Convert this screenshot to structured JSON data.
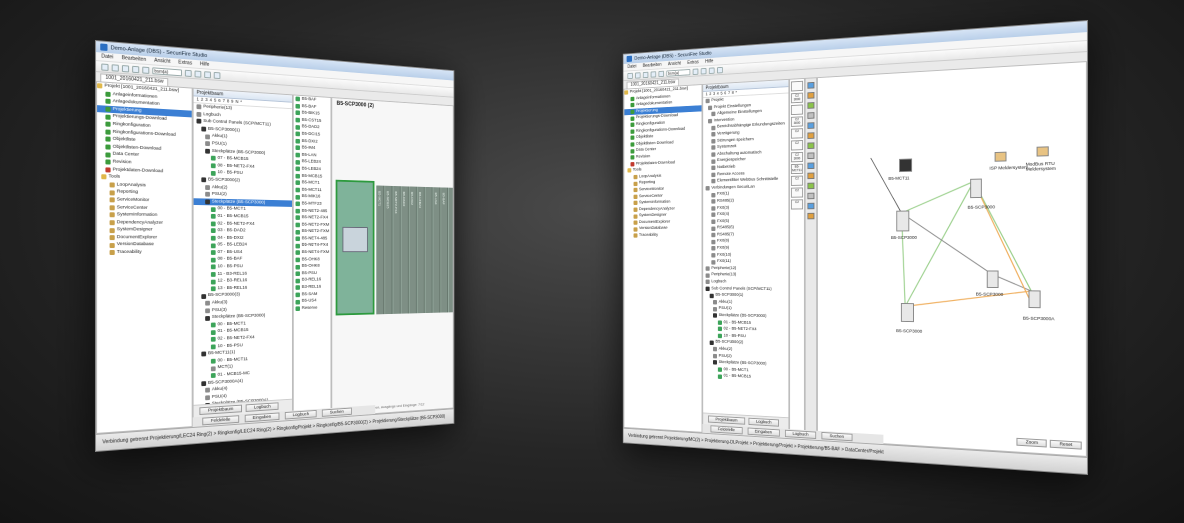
{
  "app": {
    "title": "Demo-Anlage (DBS) - SecuriFire Studio",
    "menu": [
      "Datei",
      "Bearbeiten",
      "Ansicht",
      "Extras",
      "Hilfe"
    ],
    "toolbar_select": "bsm(a)",
    "doc_tab": "1001_20160421_211.bsw"
  },
  "nav_tree": {
    "root": "Projekt [1001_20160421_211.bsw]",
    "items": [
      {
        "label": "Anlageinformationen",
        "icon": "check"
      },
      {
        "label": "Anlagedokumentation",
        "icon": "check"
      },
      {
        "label": "Projektierung",
        "icon": "check",
        "selected": true
      },
      {
        "label": "Projektierungs-Download",
        "icon": "check"
      },
      {
        "label": "Ringkonfiguration",
        "icon": "check"
      },
      {
        "label": "Ringkonfigurations-Download",
        "icon": "check"
      },
      {
        "label": "Objektliste",
        "icon": "check"
      },
      {
        "label": "Objektlisten-Download",
        "icon": "check"
      },
      {
        "label": "Data Center",
        "icon": "check"
      },
      {
        "label": "Revision",
        "icon": "check"
      },
      {
        "label": "Projektdaten-Download",
        "icon": "red"
      }
    ],
    "tools_label": "Tools",
    "tools": [
      "LoopAnalysis",
      "Reporting",
      "ServiceMonitor",
      "ServiceCenter",
      "SystemInformation",
      "DependencyAnalyzer",
      "SystemDesigner",
      "DocumentExplorer",
      "VersionDatabase",
      "Traceability"
    ]
  },
  "w1": {
    "mid_header": "Projektbaum",
    "num_strip": "1 2 3 4 5 6 7 8 9 N *",
    "mid_tree": [
      "Peripherie(13)",
      "Logbuch",
      "Sub Control Panels (SCP/MCT11)",
      "B5-SCP3000(1)",
      "Akku(1)",
      "PSU(1)",
      "Steckplätze (B5-SCP3000)",
      "07 - B5-MCB15",
      "08 - B5-NET2-FX4",
      "10 - B5-PSU",
      "B5-SCP3000(2)",
      "Akku(2)",
      "PSU(2)",
      "Steckplätze (B5-SCP3000)",
      "00 - B5-MCT1",
      "01 - B5-MCB15",
      "02 - B5-NET2-FX4",
      "03 - B5-DAD2",
      "04 - B5-DXI2",
      "05 - B5-LEB24",
      "07 - B5-US4",
      "08 - B5-BAF",
      "10 - B5-PSU",
      "11 - B3-REL16",
      "12 - B3-REL16",
      "13 - B5-REL16",
      "B5-SCP3000(3)",
      "Akku(3)",
      "PSU(3)",
      "Steckplätze (B5-SCP3000)",
      "00 - B5-MCT1",
      "01 - B5-MCB15",
      "02 - B5-NET2-FX4",
      "10 - B5-PSU",
      "B5-MCT11(1)",
      "00 - B5-MCT11",
      "MCT(1)",
      "01 - MCB15-MC",
      "B5-SCP3000A(4)",
      "Akku(4)",
      "PSU(4)",
      "Steckplätze (B5-SCP3000A)"
    ],
    "selected_mid_index": 13,
    "palette": [
      "B5-BAF",
      "B5-BAF",
      "B5-BIK15",
      "B5-CST15",
      "B5-DAD2",
      "B5-DCI15",
      "B5-DXI2",
      "B5-IM4",
      "B5-LAN",
      "B5-LEB24",
      "B5-LEB24",
      "B5-MCB15",
      "B5-MCT1",
      "B5-MCT11",
      "B5-MIK16",
      "B5-MTF23",
      "B5-NET2-485",
      "B5-NET2-FX4",
      "B5-NET2-FXM",
      "B5-NET2-FXM",
      "B5-NET4-485",
      "B5-NET4-FX4",
      "B5-NET4-FXM",
      "B5-OHK8",
      "B5-OHK8",
      "B5-PSU",
      "B3-REL16",
      "B3-REL16",
      "B5-SAM",
      "B5-US4",
      "Reserve"
    ],
    "canvas_title": "B5-SCP3000 (2)",
    "slots": [
      "B5-MCT1",
      "B5-MCB15",
      "B5-NET2-FX4",
      "B5-DAD2",
      "B5-DXI2",
      "B5-LEB24",
      "",
      "B5-US4",
      "B5-BAF",
      "",
      "B5-PSU",
      "B3-REL16",
      "B3-REL16",
      "B3-REL16"
    ],
    "canvas_hint": "Verbindende Steckergruppen, Ausgänge und Eingänge: 7/12",
    "bottom_tabs": [
      "Projektbaum",
      "Logbuch"
    ],
    "buttons": [
      "Feldelelle",
      "Eingaben",
      "Logbuch",
      "Suchen"
    ],
    "status": "Verbindung getrennt  Projektierung/LEC24 Ring(2) > Ringkonfig/LEC24 Ring(2) > RingkonfigProjekt > Ringkonfig/B5-SCP3000(2) > Projektierung/Steckplätze (B5-SCP3000)"
  },
  "w2": {
    "mid_header": "Projektbaum",
    "num_strip": "1 2 3 4 5 6 7 8 *",
    "mid_tree": [
      "Projekt",
      "Projekt Einstellungen",
      "Allgemeine Einstellungen",
      "Intervention",
      "Bereichsabhängige Erkundungszeiten",
      "Verzögerung",
      "Störungen speichern",
      "Systemzeit",
      "Abschaltung automatisch",
      "Energiespeicher",
      "Notbetrieb",
      "Remote Access",
      "Elementfilter WebBus Schnittstelle",
      "Verbindungen SecuriLan",
      "FX0(1)",
      "RS485(2)",
      "FX0(3)",
      "FX0(4)",
      "FX0(5)",
      "RS485(6)",
      "RS485(7)",
      "FX0(8)",
      "FX0(9)",
      "FX0(10)",
      "FX0(11)",
      "Peripherie(12)",
      "Peripherie(13)",
      "Logbuch",
      "Sub Control Panels (SCP/MCT11)",
      "B5-SCP3000(1)",
      "Akku(1)",
      "PSU(1)",
      "Steckplätze (B5-SCP3000)",
      "01 - B5-MCB15",
      "02 - B5-NET2-FX4",
      "10 - B5-PSU",
      "B5-SCP3000(2)",
      "Akku(2)",
      "PSU(2)",
      "Steckplätze (B5-SCP3000)",
      "00 - B5-MCT1",
      "01 - B5-MCB15"
    ],
    "palette": [
      "",
      "C2 3000",
      "",
      "C2 3000",
      "C2",
      "C2",
      "C2 3000",
      "B5-MCT11",
      "C2",
      "C2",
      "C2"
    ],
    "devices": [
      {
        "label": "B5-MCT11"
      },
      {
        "label": "ISP Meldersystem"
      },
      {
        "label": "ModBus RTU Meldersystem"
      },
      {
        "label": "B5-SCP3000"
      },
      {
        "label": "B5-SCP3000"
      },
      {
        "label": "B5-SCP3000"
      },
      {
        "label": "B5-SCP3000"
      },
      {
        "label": "B5-SCP3000A"
      }
    ],
    "buttons": [
      "Feldelelle",
      "Eingaben",
      "Logbuch",
      "Suchen"
    ],
    "zoom_buttons": [
      "Zoom",
      "Reset"
    ],
    "bottom_tabs": [
      "Projektbaum",
      "Logbuch"
    ],
    "status": "Verbindung getrennt  Projektierung/MC(2) > Projektierung-DLProjekt > Projektierung/Projekt > Projektierung/B5-BAF > DataCenter/Projekt"
  }
}
